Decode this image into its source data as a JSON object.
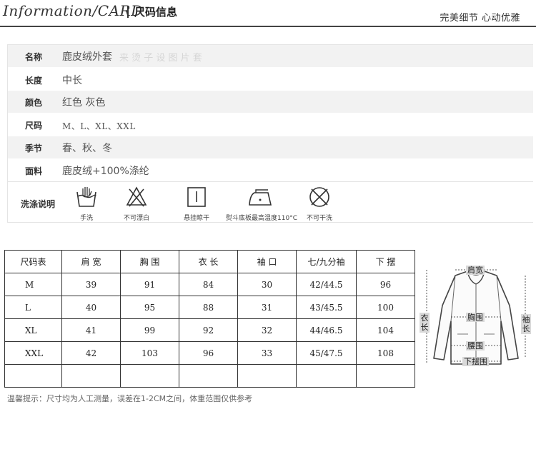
{
  "header": {
    "title": "Information/CARD",
    "subtitle": "尺码信息",
    "slogan": "完美细节  心动优雅"
  },
  "info": {
    "rows": [
      {
        "label": "名称",
        "value": "鹿皮绒外套",
        "ghost": "来 烫 子 设 图 片 套"
      },
      {
        "label": "长度",
        "value": "中长"
      },
      {
        "label": "颜色",
        "value": "红色  灰色"
      },
      {
        "label": "尺码",
        "value": "M、L、XL、XXL"
      },
      {
        "label": "季节",
        "value": "春、秋、冬"
      },
      {
        "label": "面料",
        "value": "鹿皮绒+100%涤纶"
      }
    ],
    "care_label": "洗涤说明",
    "care_items": [
      {
        "icon": "hand-wash-icon",
        "caption": "手洗"
      },
      {
        "icon": "no-bleach-icon",
        "caption": "不可漂白"
      },
      {
        "icon": "hang-dry-icon",
        "caption": "悬挂晾干"
      },
      {
        "icon": "iron-icon",
        "caption": "熨斗底板最高温度110°C"
      },
      {
        "icon": "no-dry-clean-icon",
        "caption": "不可干洗"
      }
    ]
  },
  "size_table": {
    "headers": [
      "尺码表",
      "肩 宽",
      "胸 围",
      "衣 长",
      "袖 口",
      "七/九分袖",
      "下 摆"
    ],
    "rows": [
      [
        "M",
        "39",
        "91",
        "84",
        "30",
        "42/44.5",
        "96"
      ],
      [
        "L",
        "40",
        "95",
        "88",
        "31",
        "43/45.5",
        "100"
      ],
      [
        "XL",
        "41",
        "99",
        "92",
        "32",
        "44/46.5",
        "104"
      ],
      [
        "XXL",
        "42",
        "103",
        "96",
        "33",
        "45/47.5",
        "108"
      ],
      [
        "",
        "",
        "",
        "",
        "",
        "",
        ""
      ]
    ]
  },
  "note": "温馨提示：尺寸均为人工测量，误差在1-2CM之间，体重范围仅供参考",
  "diagram": {
    "shoulder": "肩宽",
    "length": "衣长",
    "sleeve": "袖长",
    "chest": "胸围",
    "waist": "腰围",
    "hem": "下摆围"
  },
  "colors": {
    "header_rule": "#444444",
    "row_shade": "#f2f2f2",
    "diagram_label_bg": "#d9d9d9"
  }
}
